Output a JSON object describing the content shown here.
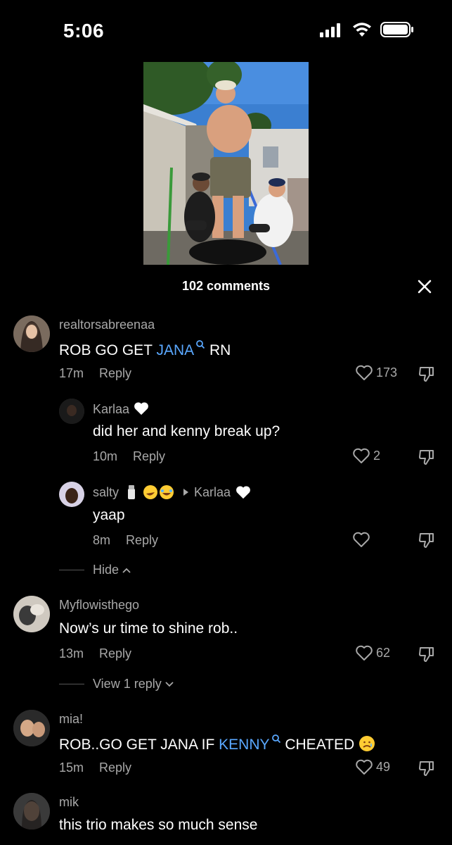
{
  "status_bar": {
    "time": "5:06"
  },
  "header": {
    "comments_count": "102 comments"
  },
  "comments": [
    {
      "username": "realtorsabreenaa",
      "text_before": "ROB GO GET ",
      "tag": "JANA",
      "text_after": " RN",
      "time": "17m",
      "reply_label": "Reply",
      "likes": "173"
    },
    {
      "username": "Karlaa",
      "text": "did her and kenny break up?",
      "time": "10m",
      "reply_label": "Reply",
      "likes": "2"
    },
    {
      "username": "salty",
      "reply_to": "Karlaa",
      "text": "yaap",
      "time": "8m",
      "reply_label": "Reply"
    },
    {
      "username": "Myflowisthego",
      "text": "Now’s ur time to shine rob..",
      "time": "13m",
      "reply_label": "Reply",
      "likes": "62"
    },
    {
      "username": "mia!",
      "text_before": "ROB..GO GET JANA IF ",
      "tag": "KENNY",
      "text_after": " CHEATED",
      "time": "15m",
      "reply_label": "Reply",
      "likes": "49"
    },
    {
      "username": "mik",
      "text": "this trio makes so much sense"
    }
  ],
  "hide_label": "Hide",
  "view_replies_label": "View 1 reply",
  "colors": {
    "background": "#000000",
    "tag": "#5aa8ff",
    "muted": "#a8a8a8"
  }
}
